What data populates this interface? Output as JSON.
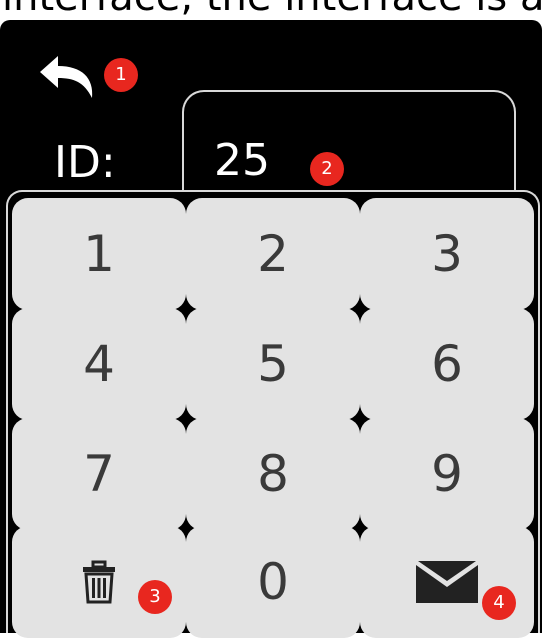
{
  "caption": "interface, the interface is as",
  "header": {
    "id_label": "ID:",
    "id_value": "25"
  },
  "keypad": {
    "keys": [
      {
        "label": "1"
      },
      {
        "label": "2"
      },
      {
        "label": "3"
      },
      {
        "label": "4"
      },
      {
        "label": "5"
      },
      {
        "label": "6"
      },
      {
        "label": "7"
      },
      {
        "label": "8"
      },
      {
        "label": "9"
      },
      {
        "label": "0"
      }
    ]
  },
  "markers": [
    "1",
    "2",
    "3",
    "4"
  ],
  "icons": {
    "back": "back-arrow-icon",
    "delete": "trash-icon",
    "send": "envelope-icon"
  },
  "colors": {
    "background": "#000000",
    "key": "#e3e3e3",
    "key_text": "#3a3a3a",
    "badge": "#e8271f",
    "border": "#d9d9d9"
  }
}
